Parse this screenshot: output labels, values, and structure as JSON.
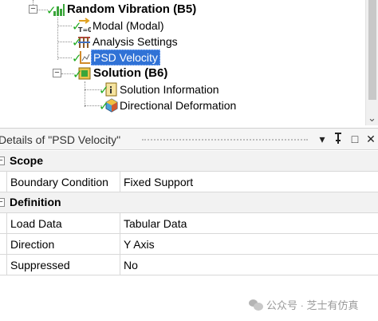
{
  "tree": {
    "nodes": [
      {
        "label": "Random Vibration (B5)",
        "icon": "random-vibration-icon",
        "status": "check"
      },
      {
        "label": "Modal (Modal)",
        "icon": "modal-link-icon",
        "icon_text": "T=0",
        "status": "check"
      },
      {
        "label": "Analysis Settings",
        "icon": "analysis-settings-icon",
        "status": "check"
      },
      {
        "label": "PSD Velocity",
        "icon": "psd-velocity-icon",
        "status": "check",
        "selected": true
      },
      {
        "label": "Solution (B6)",
        "icon": "solution-icon",
        "status": "check"
      },
      {
        "label": "Solution Information",
        "icon": "solution-information-icon",
        "status": "check"
      },
      {
        "label": "Directional Deformation",
        "icon": "directional-deformation-icon",
        "status": "check"
      }
    ]
  },
  "details": {
    "title": "Details of \"PSD Velocity\"",
    "buttons": [
      "▾",
      "ᵽ",
      "□",
      "✕"
    ]
  },
  "grid": {
    "sections": [
      {
        "label": "Scope",
        "rows": [
          {
            "name": "Boundary Condition",
            "value": "Fixed Support"
          }
        ]
      },
      {
        "label": "Definition",
        "rows": [
          {
            "name": "Load Data",
            "value": "Tabular Data"
          },
          {
            "name": "Direction",
            "value": "Y Axis"
          },
          {
            "name": "Suppressed",
            "value": "No"
          }
        ]
      }
    ]
  },
  "watermark": {
    "text": "公众号 · 芝士有仿真"
  },
  "colors": {
    "selection": "#3072d6",
    "check": "#1faa1f",
    "accent_green": "#3aa53a"
  }
}
